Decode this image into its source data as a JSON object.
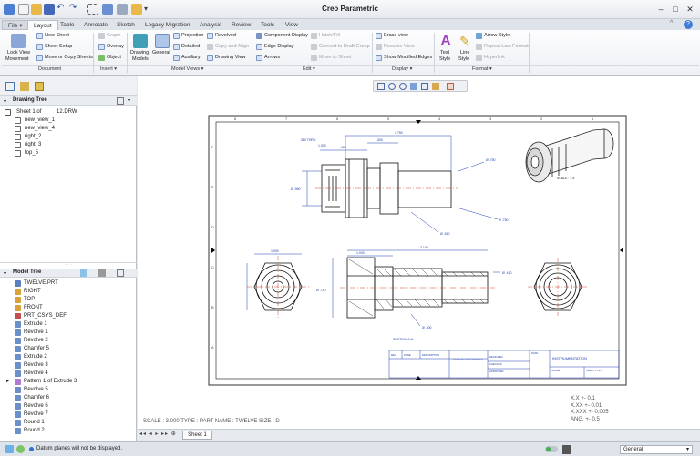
{
  "window": {
    "title": "Creo Parametric"
  },
  "tabs": [
    "File",
    "Layout",
    "Table",
    "Annotate",
    "Sketch",
    "Legacy Migration",
    "Analysis",
    "Review",
    "Tools",
    "View"
  ],
  "active_tab": "Layout",
  "ribbon": {
    "lock_view": "Lock View",
    "movement": "Movement",
    "document": {
      "new_sheet": "New Sheet",
      "sheet_setup": "Sheet Setup",
      "move_copy": "Move or Copy Sheets",
      "label": "Document"
    },
    "insert": {
      "graph": "Graph",
      "overlay": "Overlay",
      "object": "Object",
      "label": "Insert"
    },
    "model_views": {
      "drawing_models_1": "Drawing",
      "drawing_models_2": "Models",
      "general": "General",
      "projection": "Projection",
      "detailed": "Detailed",
      "auxiliary": "Auxiliary",
      "revolved": "Revolved",
      "copy_align": "Copy and Align",
      "drawing_view": "Drawing View",
      "label": "Model Views"
    },
    "edit": {
      "component_display": "Component Display",
      "edge_display": "Edge Display",
      "arrows": "Arrows",
      "hatch_fill": "Hatch/Fill",
      "convert_draft": "Convert to Draft Group",
      "move_sheet": "Move to Sheet",
      "label": "Edit"
    },
    "display": {
      "erase_view": "Erase view",
      "resume_view": "Resume View",
      "show_modified": "Show Modified Edges",
      "label": "Display"
    },
    "format": {
      "text_style_1": "Text",
      "text_style_2": "Style",
      "line_style_1": "Line",
      "line_style_2": "Style",
      "arrow_style": "Arrow Style",
      "repeat_last": "Repeat Last Format",
      "hyperlink": "Hyperlink",
      "label": "Format"
    }
  },
  "drawing_tree": {
    "title": "Drawing Tree",
    "sheet": "Sheet 1 of",
    "sheet_file": "12.DRW",
    "items": [
      "new_view_1",
      "new_view_4",
      "right_2",
      "right_3",
      "top_5"
    ]
  },
  "model_tree": {
    "title": "Model Tree",
    "items": [
      "TWELVE.PRT",
      "RIGHT",
      "TOP",
      "FRONT",
      "PRT_CSYS_DEF",
      "Extrude 1",
      "Revolve 1",
      "Revolve 2",
      "Chamfer 5",
      "Extrude 2",
      "Revolve 3",
      "Revolve 4",
      "Pattern 1 of Extrude 3",
      "Revolve 5",
      "Chamfer 6",
      "Revolve 6",
      "Revolve 7",
      "Round 1",
      "Round 2"
    ]
  },
  "drawing": {
    "title_block": "INSTRUMENTATION",
    "scale_line": "SCALE : 3.000     TYPE : PART     NAME :             TWELVE     SIZE : D",
    "tolerances": [
      "X.X   +- 0.1",
      "X.XX  +- 0.01",
      "X.XXX +- 0.005",
      "ANG.  +- 0.5"
    ],
    "section_label": "SECTION  A-A",
    "zone_top": [
      "8",
      "7",
      "6",
      "5",
      "4",
      "3",
      "2",
      "1"
    ],
    "zone_side": [
      "F",
      "E",
      "D",
      "C",
      "B",
      "A"
    ]
  },
  "sheet_tabs": {
    "sheet1": "Sheet 1"
  },
  "status": {
    "message": "Datum planes will not be displayed.",
    "filter": "General"
  },
  "colors": {
    "accent_blue": "#1f3fb0",
    "dim_blue": "#2a4bd7",
    "ribbon_bg": "#eef0f4",
    "active_tab_bg": "#fafbfc"
  }
}
